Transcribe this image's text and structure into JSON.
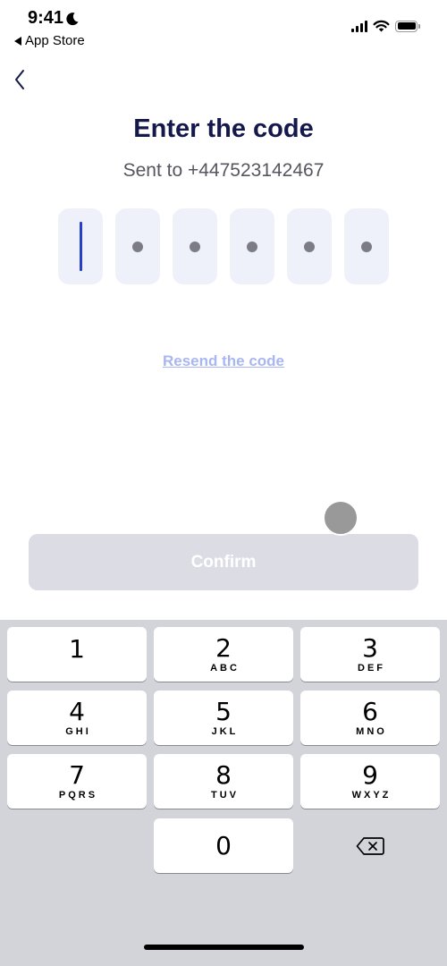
{
  "status_bar": {
    "time": "9:41",
    "back_app_label": "App Store",
    "icons": [
      "moon-icon",
      "signal-icon",
      "wifi-icon",
      "battery-icon"
    ]
  },
  "nav": {
    "back_icon": "chevron-left-icon"
  },
  "header": {
    "title": "Enter the code",
    "subtitle": "Sent to +447523142467"
  },
  "code_input": {
    "length": 6,
    "filled": 0,
    "active_index": 0,
    "placeholder_glyph": "•"
  },
  "resend_link": "Resend the code",
  "confirm_button": {
    "label": "Confirm",
    "enabled": false
  },
  "colors": {
    "title": "#15184a",
    "cursor": "#2740c8",
    "link": "#a8b6f2",
    "box_bg": "#eff1fa",
    "button_disabled": "#dcdce5",
    "keyboard_bg": "#d3d3da"
  },
  "keypad": {
    "keys": [
      {
        "digit": "1",
        "letters": ""
      },
      {
        "digit": "2",
        "letters": "ABC"
      },
      {
        "digit": "3",
        "letters": "DEF"
      },
      {
        "digit": "4",
        "letters": "GHI"
      },
      {
        "digit": "5",
        "letters": "JKL"
      },
      {
        "digit": "6",
        "letters": "MNO"
      },
      {
        "digit": "7",
        "letters": "PQRS"
      },
      {
        "digit": "8",
        "letters": "TUV"
      },
      {
        "digit": "9",
        "letters": "WXYZ"
      },
      {
        "digit": "0",
        "letters": ""
      }
    ],
    "delete_icon": "backspace-icon"
  }
}
